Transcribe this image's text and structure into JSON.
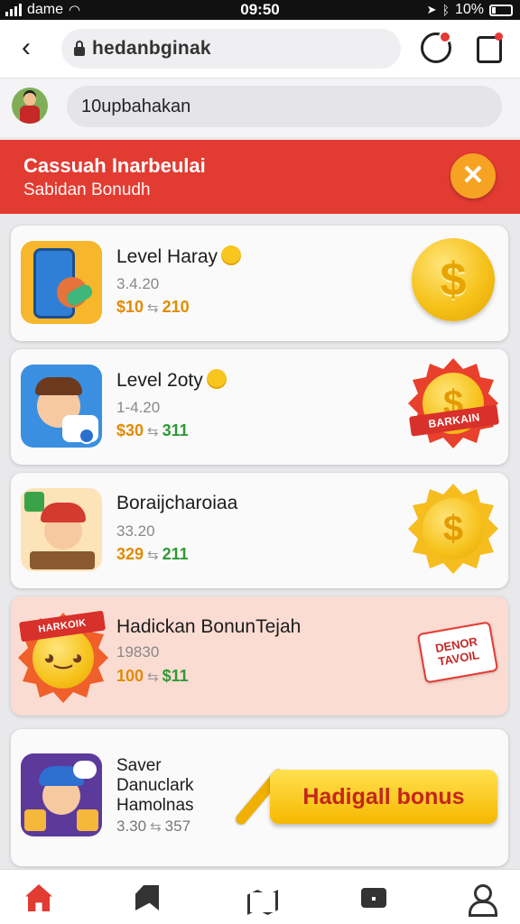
{
  "status_bar": {
    "carrier": "dame",
    "time": "09:50",
    "battery": "10%"
  },
  "browser": {
    "url_domain": "hedanbginak"
  },
  "search": {
    "value": "10upbahakan"
  },
  "banner": {
    "title": "Cassuah Inarbeulai",
    "subtitle": "Sabidan Bonudh",
    "close_label": "✕",
    "color": "#e23b32"
  },
  "items": [
    {
      "title": "Level Haray",
      "count": "3.4.20",
      "price_a": "$10",
      "price_b": "210"
    },
    {
      "title": "Level 2oty",
      "count": "1-4.20",
      "price_a": "$30",
      "price_b": "311",
      "badge": "BARKAIN"
    },
    {
      "title": "Boraijcharoiaa",
      "count": "33.20",
      "price_a": "329",
      "price_b": "211"
    },
    {
      "title": "Hadickan BonunTejah",
      "count": "19830",
      "price_a": "100",
      "price_b": "$11",
      "badge": "HARKOIK",
      "sticker": "DENOR TAVOIL"
    },
    {
      "title_lines": [
        "Saver",
        "Danuclark",
        "Hamolnas"
      ],
      "price_a": "3.30",
      "price_b": "357"
    }
  ],
  "bonus_button": "Hadigall bonus",
  "accent": "#e23b32",
  "icons": [
    "back-icon",
    "lock-icon",
    "refresh-icon",
    "share-icon",
    "close-icon",
    "coin-icon",
    "home-icon",
    "bookmark-icon",
    "map-icon",
    "chat-icon",
    "profile-icon"
  ]
}
